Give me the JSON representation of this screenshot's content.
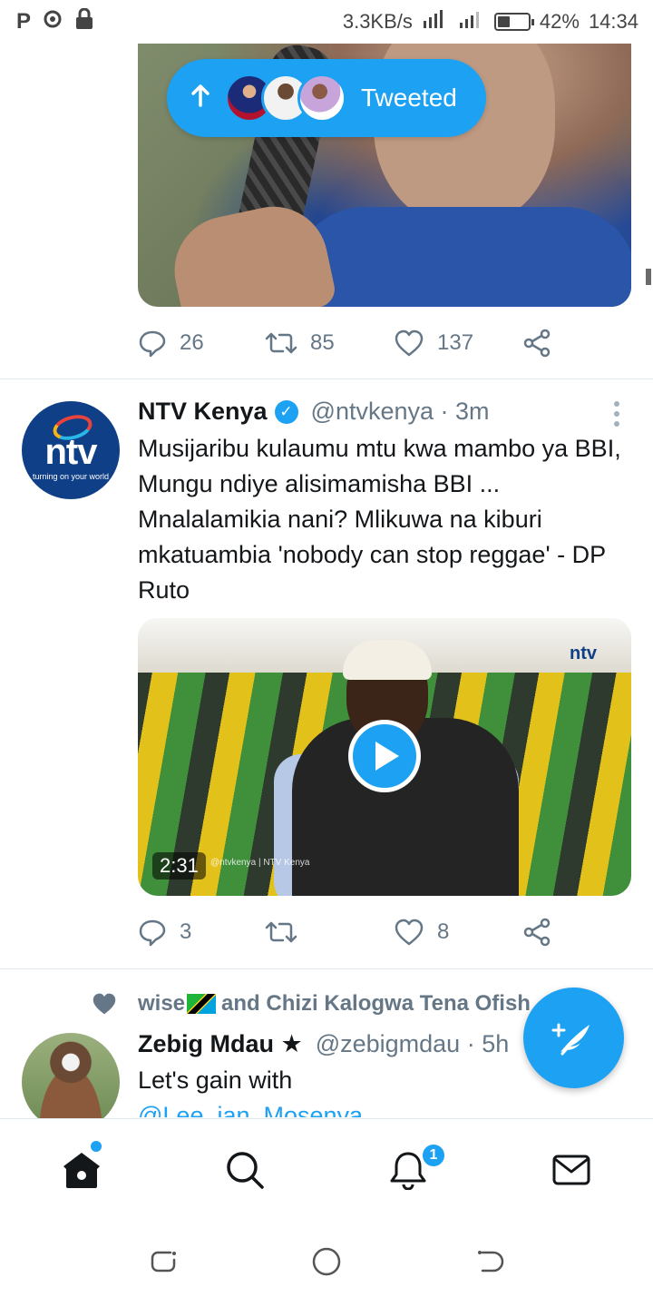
{
  "status_bar": {
    "left_icons": [
      "P",
      "notification-icon",
      "lock-icon"
    ],
    "speed": "3.3KB/s",
    "battery": "42%",
    "battery_level": 0.42,
    "time": "14:34"
  },
  "retweet_pill": {
    "label": "Tweeted"
  },
  "tweet1": {
    "reply_count": "26",
    "retweet_count": "85",
    "like_count": "137"
  },
  "tweet2": {
    "name": "NTV Kenya",
    "handle": "@ntvkenya · 3m",
    "text": "Musijaribu kulaumu mtu kwa mambo ya BBI, Mungu ndiye alisimamisha BBI ... Mnalalamikia nani? Mlikuwa na kiburi mkatuambia 'nobody can stop reggae' - DP Ruto",
    "avatar_logo": "ntv",
    "avatar_tagline": "turning on your world",
    "video": {
      "duration": "2:31",
      "watermark": "ntv",
      "caption": "@ntvkenya | NTV Kenya"
    },
    "reply_count": "3",
    "like_count": "8"
  },
  "tweet3": {
    "liked_by": "wise",
    "liked_by_rest": "and Chizi Kalogwa Tena Ofish",
    "name": "Zebig Mdau ★",
    "handle": "@zebigmdau · 5h",
    "text": "Let's gain with",
    "mention": "@Lee_ian_Mosenya"
  },
  "bottom_nav": {
    "notifications_badge": "1"
  },
  "colors": {
    "accent": "#1da1f2",
    "secondary_text": "#657786"
  }
}
